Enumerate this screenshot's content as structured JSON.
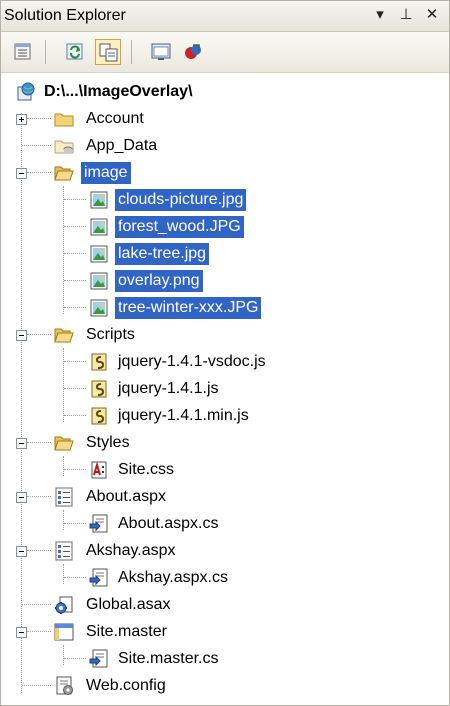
{
  "window": {
    "title": "Solution Explorer"
  },
  "title_buttons": [
    {
      "name": "window-position-button",
      "glyph": "▾"
    },
    {
      "name": "auto-hide-pin-button",
      "glyph": "⊥"
    },
    {
      "name": "close-button",
      "glyph": "✕"
    }
  ],
  "toolbar": {
    "buttons": [
      {
        "name": "properties-button",
        "icon": "properties-icon"
      },
      {
        "name": "refresh-button",
        "icon": "refresh-icon"
      },
      {
        "name": "nest-related-files-button",
        "icon": "nest-related-files-icon",
        "active": true
      },
      {
        "name": "view-in-browser-button",
        "icon": "view-in-browser-icon"
      },
      {
        "name": "copy-web-site-button",
        "icon": "copy-web-site-icon"
      }
    ]
  },
  "tree": {
    "root": "D:\\...\\ImageOverlay\\",
    "items": [
      {
        "label": "Account",
        "icon": "folder-icon",
        "expander": "plus"
      },
      {
        "label": "App_Data",
        "icon": "app-data-folder-icon"
      },
      {
        "label": "image",
        "icon": "folder-open-icon",
        "expander": "minus",
        "selected": true
      },
      {
        "label": "clouds-picture.jpg",
        "icon": "image-file-icon",
        "selected": true
      },
      {
        "label": "forest_wood.JPG",
        "icon": "image-file-icon",
        "selected": true
      },
      {
        "label": "lake-tree.jpg",
        "icon": "image-file-icon",
        "selected": true
      },
      {
        "label": "overlay.png",
        "icon": "image-file-icon",
        "selected": true
      },
      {
        "label": "tree-winter-xxx.JPG",
        "icon": "image-file-icon",
        "selected": true
      },
      {
        "label": "Scripts",
        "icon": "folder-open-icon",
        "expander": "minus"
      },
      {
        "label": "jquery-1.4.1-vsdoc.js",
        "icon": "script-file-icon"
      },
      {
        "label": "jquery-1.4.1.js",
        "icon": "script-file-icon"
      },
      {
        "label": "jquery-1.4.1.min.js",
        "icon": "script-file-icon"
      },
      {
        "label": "Styles",
        "icon": "folder-open-icon",
        "expander": "minus"
      },
      {
        "label": "Site.css",
        "icon": "css-file-icon"
      },
      {
        "label": "About.aspx",
        "icon": "aspx-page-icon",
        "expander": "minus"
      },
      {
        "label": "About.aspx.cs",
        "icon": "code-behind-icon"
      },
      {
        "label": "Akshay.aspx",
        "icon": "aspx-page-icon",
        "expander": "minus"
      },
      {
        "label": "Akshay.aspx.cs",
        "icon": "code-behind-icon"
      },
      {
        "label": "Global.asax",
        "icon": "global-asax-icon"
      },
      {
        "label": "Site.master",
        "icon": "master-page-icon",
        "expander": "minus"
      },
      {
        "label": "Site.master.cs",
        "icon": "code-behind-icon"
      },
      {
        "label": "Web.config",
        "icon": "web-config-icon"
      }
    ]
  }
}
